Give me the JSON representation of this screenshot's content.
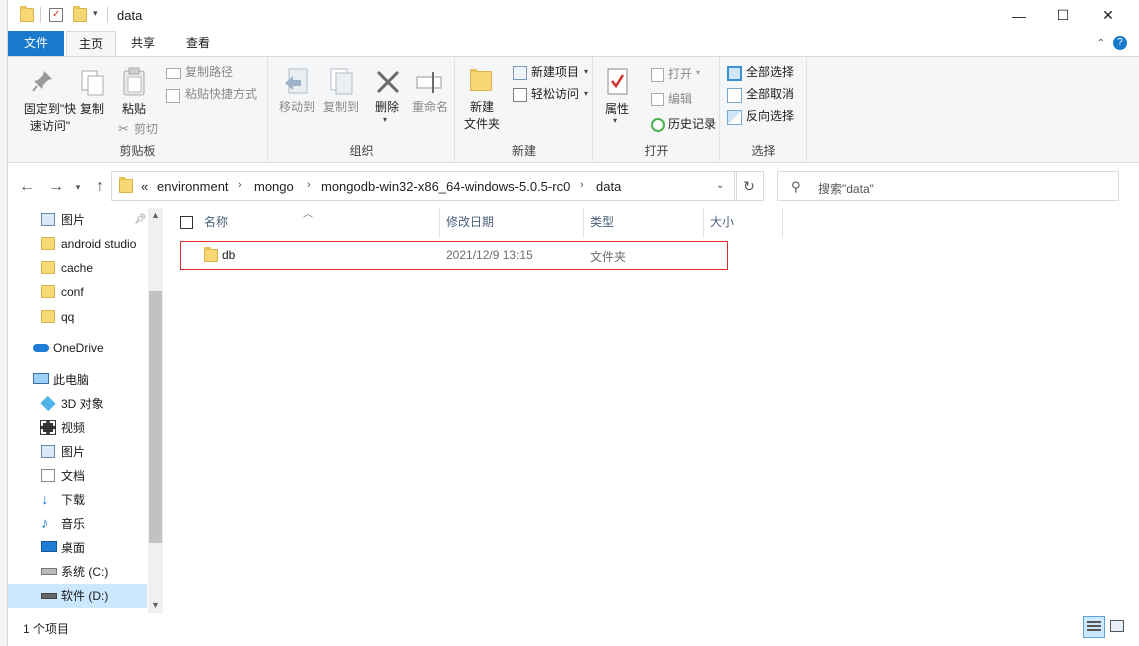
{
  "window": {
    "title": "data",
    "controls": {
      "minimize": "—",
      "maximize": "☐",
      "close": "✕"
    }
  },
  "ribbon_tabs": [
    {
      "label": "文件",
      "active": false
    },
    {
      "label": "主页",
      "active": true
    },
    {
      "label": "共享",
      "active": false
    },
    {
      "label": "查看",
      "active": false
    }
  ],
  "ribbon": {
    "clipboard": {
      "group_label": "剪贴板",
      "pin_label_line1": "固定到\"快",
      "pin_label_line2": "速访问\"",
      "copy_label": "复制",
      "paste_label": "粘贴",
      "cut_label": "剪切",
      "copy_path_label": "复制路径",
      "paste_shortcut_label": "粘贴快捷方式"
    },
    "organize": {
      "group_label": "组织",
      "move_to_label": "移动到",
      "copy_to_label": "复制到",
      "delete_label": "删除",
      "rename_label": "重命名"
    },
    "new": {
      "group_label": "新建",
      "new_folder_line1": "新建",
      "new_folder_line2": "文件夹",
      "new_item_label": "新建项目",
      "easy_access_label": "轻松访问"
    },
    "open": {
      "group_label": "打开",
      "properties_label": "属性",
      "open_label": "打开",
      "edit_label": "编辑",
      "history_label": "历史记录"
    },
    "select": {
      "group_label": "选择",
      "select_all_label": "全部选择",
      "select_none_label": "全部取消",
      "invert_label": "反向选择"
    }
  },
  "address": {
    "overflow": "«",
    "breadcrumbs": [
      "environment",
      "mongo",
      "mongodb-win32-x86_64-windows-5.0.5-rc0",
      "data"
    ]
  },
  "search": {
    "placeholder": "搜索\"data\""
  },
  "nav_pane": {
    "items": [
      {
        "label": "图片",
        "icon": "pictures-icon",
        "pinned": true
      },
      {
        "label": "android studio",
        "icon": "folder-icon"
      },
      {
        "label": "cache",
        "icon": "folder-icon"
      },
      {
        "label": "conf",
        "icon": "folder-icon"
      },
      {
        "label": "qq",
        "icon": "folder-icon"
      },
      {
        "label": "OneDrive",
        "icon": "onedrive-icon"
      },
      {
        "label": "此电脑",
        "icon": "this-pc-icon"
      },
      {
        "label": "3D 对象",
        "icon": "3d-objects-icon"
      },
      {
        "label": "视频",
        "icon": "videos-icon"
      },
      {
        "label": "图片",
        "icon": "pictures-icon"
      },
      {
        "label": "文档",
        "icon": "documents-icon"
      },
      {
        "label": "下载",
        "icon": "downloads-icon"
      },
      {
        "label": "音乐",
        "icon": "music-icon"
      },
      {
        "label": "桌面",
        "icon": "desktop-icon"
      },
      {
        "label": "系统 (C:)",
        "icon": "drive-c-icon"
      },
      {
        "label": "软件 (D:)",
        "icon": "drive-d-icon",
        "selected": true
      }
    ]
  },
  "file_list": {
    "columns": [
      "名称",
      "修改日期",
      "类型",
      "大小"
    ],
    "rows": [
      {
        "name": "db",
        "modified": "2021/12/9 13:15",
        "type": "文件夹",
        "size": ""
      }
    ]
  },
  "status_bar": {
    "item_count": "1 个项目"
  },
  "colors": {
    "accent": "#1979ca",
    "selection": "#cce8ff",
    "highlight_border": "#e02a2a",
    "folder": "#f8d775"
  }
}
